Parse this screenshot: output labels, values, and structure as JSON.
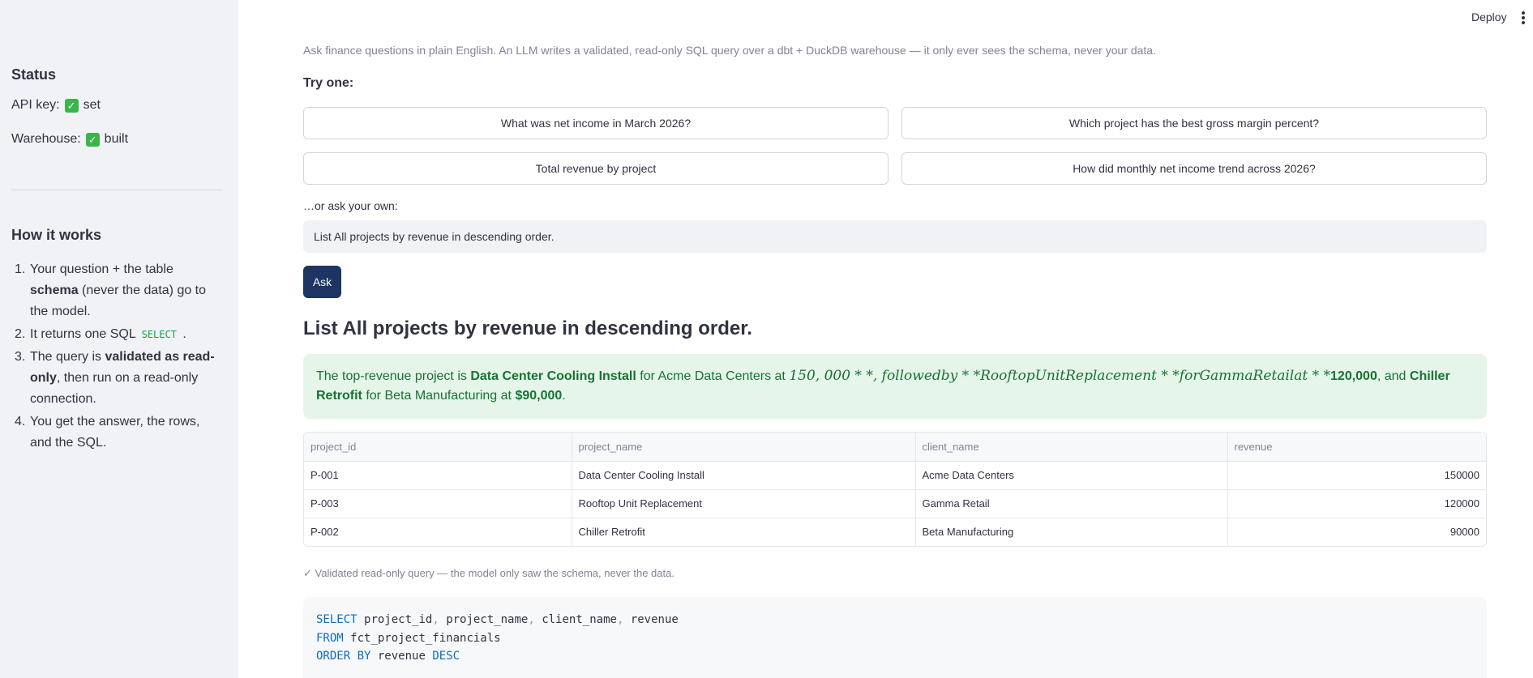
{
  "header": {
    "deploy_label": "Deploy"
  },
  "sidebar": {
    "status_title": "Status",
    "api_key_label": "API key:",
    "api_key_value": "set",
    "warehouse_label": "Warehouse:",
    "warehouse_value": "built",
    "how_title": "How it works",
    "steps": [
      {
        "num": "1.",
        "pre": "Your question + the table ",
        "bold": "schema",
        "post": " (never the data) go to the model."
      },
      {
        "num": "2.",
        "pre": "It returns one SQL ",
        "code": "SELECT",
        "post": " ."
      },
      {
        "num": "3.",
        "pre": "The query is ",
        "bold": "validated as read-only",
        "post": ", then run on a read-only connection."
      },
      {
        "num": "4.",
        "pre": "You get the answer, the rows, and the SQL."
      }
    ]
  },
  "main": {
    "caption": "Ask finance questions in plain English. An LLM writes a validated, read-only SQL query over a dbt + DuckDB warehouse — it only ever sees the schema, never your data.",
    "try_label": "Try one:",
    "examples": [
      "What was net income in March 2026?",
      "Which project has the best gross margin percent?",
      "Total revenue by project",
      "How did monthly net income trend across 2026?"
    ],
    "own_label": "…or ask your own:",
    "question_value": "List All projects by revenue in descending order.",
    "ask_label": "Ask",
    "question_heading": "List All projects by revenue in descending order.",
    "answer": {
      "p1": "The top-revenue project is ",
      "b1": "Data Center Cooling Install",
      "p2": " for Acme Data Centers at ",
      "math": "150, 000 * *, followedby * *RooftopUnitReplacement * *forGammaRetailat * *",
      "b2": "120,000",
      "p3": ", and ",
      "b3": "Chiller Retrofit",
      "p4": " for Beta Manufacturing at ",
      "b4": "$90,000",
      "p5": "."
    },
    "table": {
      "columns": [
        "project_id",
        "project_name",
        "client_name",
        "revenue"
      ],
      "rows": [
        [
          "P-001",
          "Data Center Cooling Install",
          "Acme Data Centers",
          "150000"
        ],
        [
          "P-003",
          "Rooftop Unit Replacement",
          "Gamma Retail",
          "120000"
        ],
        [
          "P-002",
          "Chiller Retrofit",
          "Beta Manufacturing",
          "90000"
        ]
      ]
    },
    "validated_note": "✓ Validated read-only query — the model only saw the schema, never the data.",
    "sql": {
      "select_kw": "SELECT",
      "select_cols": [
        "project_id",
        "project_name",
        "client_name",
        "revenue"
      ],
      "from_kw": "FROM",
      "from_table": "fct_project_financials",
      "order_kw": "ORDER BY",
      "order_col": "revenue",
      "dir_kw": "DESC"
    }
  }
}
